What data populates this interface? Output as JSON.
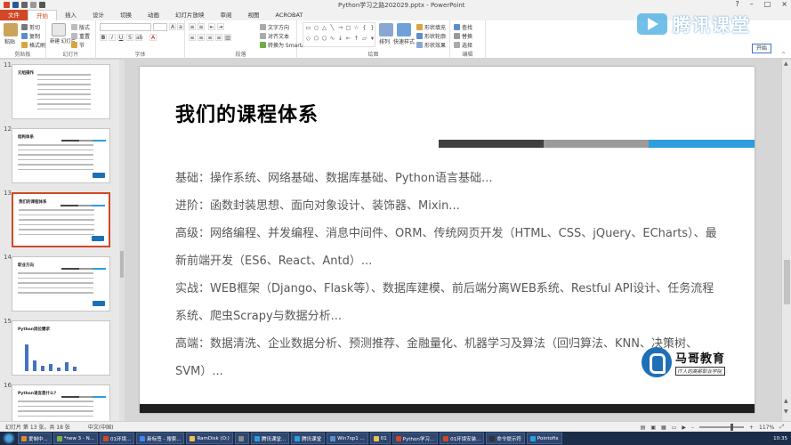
{
  "window": {
    "title": "Python学习之路202029.pptx - PowerPoint",
    "controls": [
      "?",
      "–",
      "□",
      "×"
    ]
  },
  "ribbon_tabs": [
    "文件",
    "开始",
    "插入",
    "设计",
    "切换",
    "动画",
    "幻灯片放映",
    "审阅",
    "视图",
    "ACROBAT"
  ],
  "ribbon": {
    "clipboard": {
      "paste": "粘贴",
      "cut": "剪切",
      "copy": "复制",
      "format_painter": "格式刷",
      "label": "剪贴板"
    },
    "slides": {
      "new_slide": "新建\n幻灯片",
      "layout": "版式",
      "reset": "重置",
      "section": "节",
      "label": "幻灯片"
    },
    "font": {
      "label": "字体"
    },
    "paragraph": {
      "text_direction": "文字方向",
      "align_text": "对齐文本",
      "convert_smartart": "转换为 SmartArt",
      "label": "段落"
    },
    "drawing": {
      "arrange": "排列",
      "quick_styles": "快速样式",
      "fill": "形状填充",
      "outline": "形状轮廓",
      "effects": "形状效果",
      "label": "绘图"
    },
    "editing": {
      "find": "查找",
      "replace": "替换",
      "select": "选择",
      "label": "编辑"
    },
    "start_button": "开始"
  },
  "watermark": {
    "text": "腾讯课堂"
  },
  "thumbnails": [
    {
      "num": "11",
      "title": "元组操作"
    },
    {
      "num": "12",
      "title": "结构体系"
    },
    {
      "num": "13",
      "title": "我们的课程体系",
      "selected": true
    },
    {
      "num": "14",
      "title": "职业方向"
    },
    {
      "num": "15",
      "title": "Python岗位需求"
    },
    {
      "num": "16",
      "title": "Python语言是什么?"
    }
  ],
  "slide": {
    "heading": "我们的课程体系",
    "lines": [
      "基础：操作系统、网络基础、数据库基础、Python语言基础...",
      "进阶：函数封装思想、面向对象设计、装饰器、Mixin...",
      "高级：网络编程、并发编程、消息中间件、ORM、传统网页开发（HTML、CSS、jQuery、ECharts）、最",
      "新前端开发（ES6、React、Antd）...",
      "实战：WEB框架（Django、Flask等）、数据库建模、前后端分离WEB系统、Restful API设计、任务流程",
      "系统、爬虫Scrapy与数据分析...",
      "高端：数据清洗、企业数据分析、预测推荐、金融量化、机器学习及算法（回归算法、KNN、决策树、",
      "SVM）..."
    ],
    "bar_colors": [
      "#404040",
      "#9b9b9b",
      "#2d9ddc"
    ],
    "logo_name": "马哥教育",
    "logo_tagline": "IT人的高薪职业学院"
  },
  "status": {
    "slide_count": "幻灯片 第 13 张，共 18 张",
    "language": "中文(中国)",
    "zoom": "117%"
  },
  "taskbar": {
    "items": [
      "爱制中...",
      "*new 3 - N...",
      "01环境...",
      "新标签 - 搜索...",
      "RamDisk (O:)",
      "",
      "腾讯课堂...",
      "腾讯课堂",
      "Win7sp1 ...",
      "01",
      "Python学习...",
      "01环境安装...",
      "命令提示符",
      "Pointofix"
    ],
    "clock": "10:35"
  }
}
